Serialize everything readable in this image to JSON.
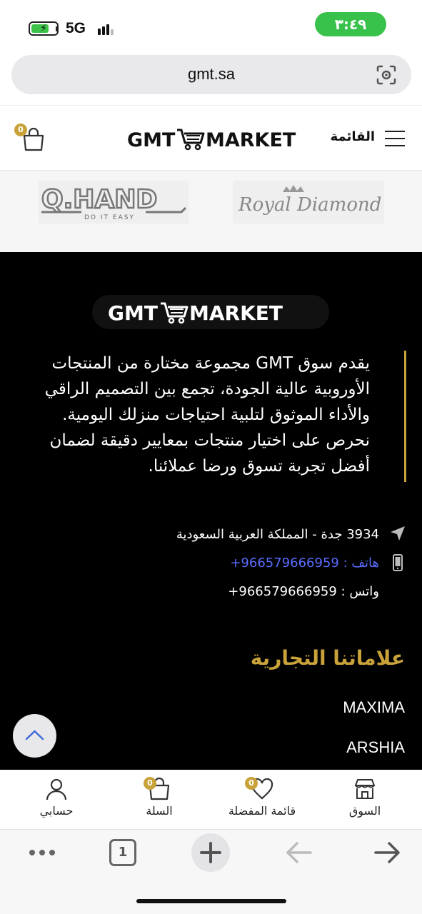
{
  "status_bar": {
    "time": "٣:٤٩",
    "network": "5G",
    "battery_icon": "battery-charging-icon",
    "signal_icon": "signal-bars-icon"
  },
  "browser": {
    "url": "gmt.sa",
    "lens_icon": "camera-lens-icon",
    "tabs_count": "1"
  },
  "header": {
    "menu_label": "القائمة",
    "logo_text": "GMT MARKET",
    "cart_count": "0"
  },
  "brand_logos": {
    "qhand_main": "Q.HAND",
    "qhand_tag": "DO  IT  EASY",
    "royal": "Royal Diamond"
  },
  "footer": {
    "logo_text": "GMT MARKET",
    "about": "يقدم سوق GMT مجموعة مختارة من المنتجات الأوروبية عالية الجودة، تجمع بين التصميم الراقي والأداء الموثوق لتلبية احتياجات منزلك اليومية. نحرص على اختيار منتجات بمعايير دقيقة لضمان أفضل تجربة تسوق ورضا عملائنا.",
    "address": "3934 جدة - المملكة العربية السعودية",
    "phone": "هاتف : 966579666959+",
    "whatsapp": "واتس : 966579666959+",
    "brands_title": "علاماتنا التجارية",
    "brands": [
      "MAXIMA",
      "ARSHIA"
    ]
  },
  "bottom_nav": {
    "items": [
      {
        "label": "السوق",
        "icon": "store-icon"
      },
      {
        "label": "قائمة المفضلة",
        "icon": "heart-icon",
        "badge": "0"
      },
      {
        "label": "السلة",
        "icon": "shopping-bag-icon",
        "badge": "0"
      },
      {
        "label": "حسابي",
        "icon": "user-icon"
      }
    ]
  },
  "colors": {
    "accent_gold": "#c9a23a",
    "status_green": "#38c24c",
    "link_blue": "#5b6cff",
    "footer_bg": "#000000"
  }
}
